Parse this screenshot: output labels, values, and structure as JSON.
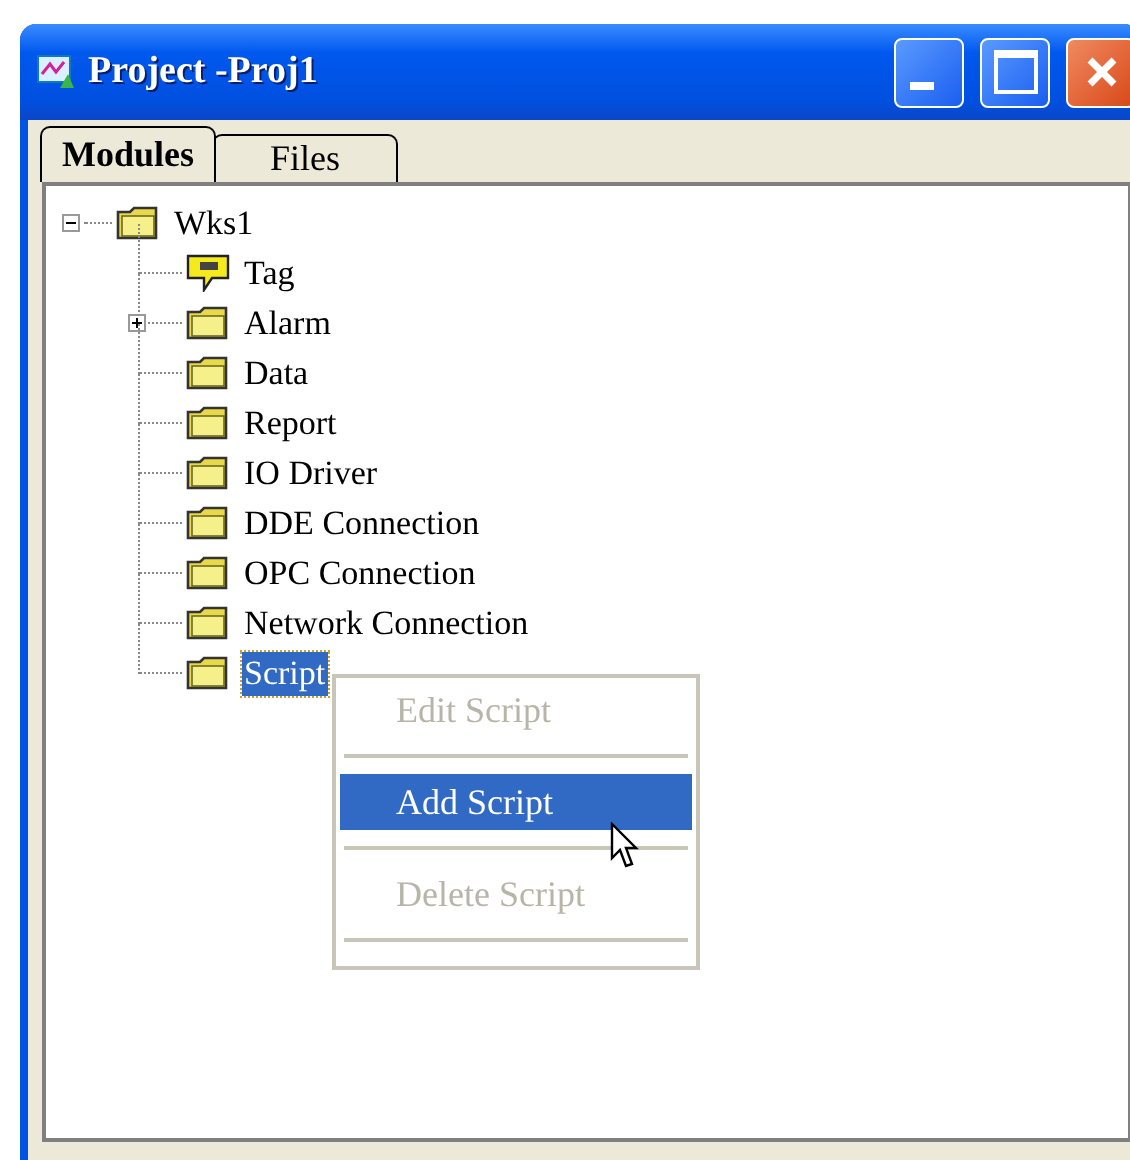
{
  "window": {
    "title": "Project -Proj1"
  },
  "tabs": [
    {
      "label": "Modules",
      "selected": true
    },
    {
      "label": "Files",
      "selected": false
    }
  ],
  "tree": [
    {
      "label": "Wks1",
      "kind": "folder",
      "expanded": true,
      "selected": false,
      "children": [
        {
          "label": "Tag",
          "kind": "tag",
          "selected": false
        },
        {
          "label": "Alarm",
          "kind": "folder",
          "expanded": false,
          "selected": false
        },
        {
          "label": "Data",
          "kind": "folder",
          "selected": false
        },
        {
          "label": "Report",
          "kind": "folder",
          "selected": false
        },
        {
          "label": "IO Driver",
          "kind": "folder",
          "selected": false
        },
        {
          "label": "DDE Connection",
          "kind": "folder",
          "selected": false
        },
        {
          "label": "OPC Connection",
          "kind": "folder",
          "selected": false
        },
        {
          "label": "Network Connection",
          "kind": "folder",
          "selected": false
        },
        {
          "label": "Script",
          "kind": "folder",
          "selected": true
        }
      ]
    }
  ],
  "context_menu": [
    {
      "label": "Edit Script",
      "disabled": true,
      "selected": false
    },
    {
      "label": "Add Script",
      "disabled": false,
      "selected": true
    },
    {
      "label": "Delete Script",
      "disabled": true,
      "selected": false
    }
  ]
}
